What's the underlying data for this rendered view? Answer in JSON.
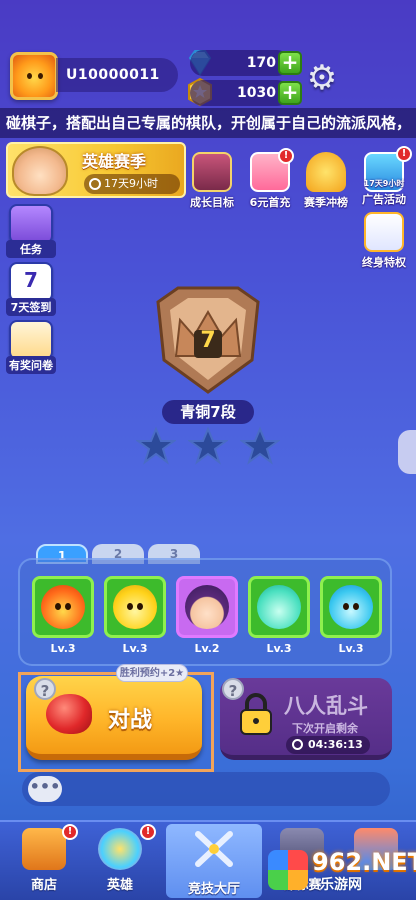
{
  "player": {
    "uid": "U10000011"
  },
  "resources": {
    "diamonds": "170",
    "coins": "1030"
  },
  "ticker": {
    "text": "碰棋子，搭配出自己专属的棋队，开创属于自己的流派风格，"
  },
  "season": {
    "title": "英雄赛季",
    "timer": "17天9小时"
  },
  "features": [
    {
      "label": "成长目标"
    },
    {
      "label": "6元首充"
    },
    {
      "label": "赛季冲榜"
    },
    {
      "label": "广告活动",
      "sub": "17天9小时"
    },
    {
      "label": "终身特权"
    }
  ],
  "side": [
    {
      "label": "任务"
    },
    {
      "label": "7天签到"
    },
    {
      "label": "有奖问卷"
    }
  ],
  "rank": {
    "number": "7",
    "name": "青铜7段",
    "stars_filled": 0,
    "stars_total": 3
  },
  "lineup": {
    "tabs": [
      "1",
      "2",
      "3"
    ],
    "active_tab": "1",
    "heroes": [
      {
        "level": "Lv.3"
      },
      {
        "level": "Lv.3"
      },
      {
        "level": "Lv.2"
      },
      {
        "level": "Lv.3"
      },
      {
        "level": "Lv.3"
      }
    ]
  },
  "battle": {
    "label": "对战",
    "reward": "胜利预约+2★"
  },
  "eight_player": {
    "name": "八人乱斗",
    "sub": "下次开启剩余",
    "countdown": "04:36:13"
  },
  "chat": {
    "label": "•••"
  },
  "nav": [
    {
      "label": "商店"
    },
    {
      "label": "英雄"
    },
    {
      "label": "竞技大厅"
    },
    {
      "label": "锦标赛"
    },
    {
      "label": ""
    }
  ],
  "watermark": {
    "main": "962.NET",
    "sub": "乐游网"
  },
  "colors": {
    "accent": "#ffb62a",
    "primary_bg": "#4a52d6",
    "positive": "#3fa51d",
    "alert": "#e12a2a"
  }
}
